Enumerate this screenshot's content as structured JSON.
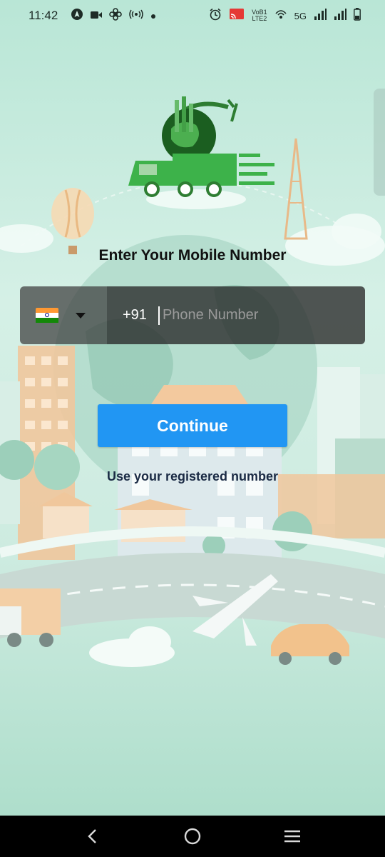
{
  "status_bar": {
    "time": "11:42",
    "left_icons": [
      "navigation-icon",
      "video-icon",
      "fan-icon",
      "hotspot-icon",
      "dot-icon"
    ],
    "right_icons": [
      "alarm-icon",
      "cast-icon",
      "volte-icon",
      "wifi-calling-icon",
      "signal-icon",
      "signal-icon",
      "battery-icon"
    ],
    "volte_line1": "VoB1",
    "volte_line2": "LTE2",
    "network": "5G"
  },
  "login": {
    "title": "Enter Your Mobile Number",
    "country_flag": "india-flag-icon",
    "dial_code": "+91",
    "phone_placeholder": "Phone Number",
    "phone_value": "",
    "continue_label": "Continue",
    "hint": "Use your registered number"
  },
  "nav_bar": {
    "icons": [
      "back-icon",
      "home-icon",
      "recents-icon"
    ]
  },
  "colors": {
    "accent": "#2196f3",
    "logo_green": "#3db24a",
    "background": "#cdebe0"
  }
}
